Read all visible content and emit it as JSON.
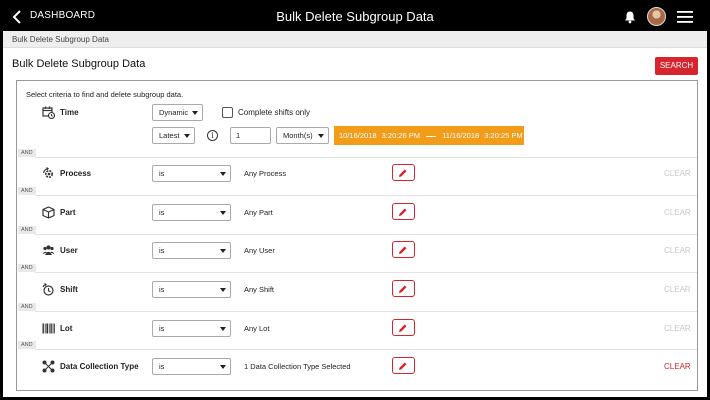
{
  "header": {
    "back_label": "DASHBOARD",
    "title": "Bulk Delete Subgroup Data",
    "icons": [
      "chevron-left-icon",
      "bell-icon",
      "avatar",
      "hamburger-menu-icon"
    ]
  },
  "breadcrumb": "Bulk Delete Subgroup Data",
  "page": {
    "title": "Bulk Delete Subgroup Data",
    "search_label": "SEARCH"
  },
  "panel": {
    "intro": "Select criteria to find and delete subgroup data.",
    "connector": "AND",
    "time": {
      "label": "Time",
      "mode": "Dynamic",
      "complete_shifts_label": "Complete shifts only",
      "relative": "Latest",
      "count": "1",
      "unit": "Month(s)",
      "start_date": "10/16/2018",
      "start_time": "3:20:26 PM",
      "end_date": "11/16/2018",
      "end_time": "3:20:25 PM"
    },
    "rows": [
      {
        "label": "Process",
        "operator": "is",
        "value": "Any Process",
        "clear": "CLEAR",
        "icon": "process-gear-icon",
        "active": false
      },
      {
        "label": "Part",
        "operator": "is",
        "value": "Any Part",
        "clear": "CLEAR",
        "icon": "box-icon",
        "active": false
      },
      {
        "label": "User",
        "operator": "is",
        "value": "Any User",
        "clear": "CLEAR",
        "icon": "users-icon",
        "active": false
      },
      {
        "label": "Shift",
        "operator": "is",
        "value": "Any Shift",
        "clear": "CLEAR",
        "icon": "shift-clock-icon",
        "active": false
      },
      {
        "label": "Lot",
        "operator": "is",
        "value": "Any Lot",
        "clear": "CLEAR",
        "icon": "barcode-icon",
        "active": false
      },
      {
        "label": "Data Collection Type",
        "operator": "is",
        "value": "1 Data Collection Type Selected",
        "clear": "CLEAR",
        "icon": "network-nodes-icon",
        "active": true
      }
    ]
  },
  "colors": {
    "accent_red": "#d6252c",
    "date_range_orange": "#f39c1a",
    "topbar": "#000000"
  }
}
